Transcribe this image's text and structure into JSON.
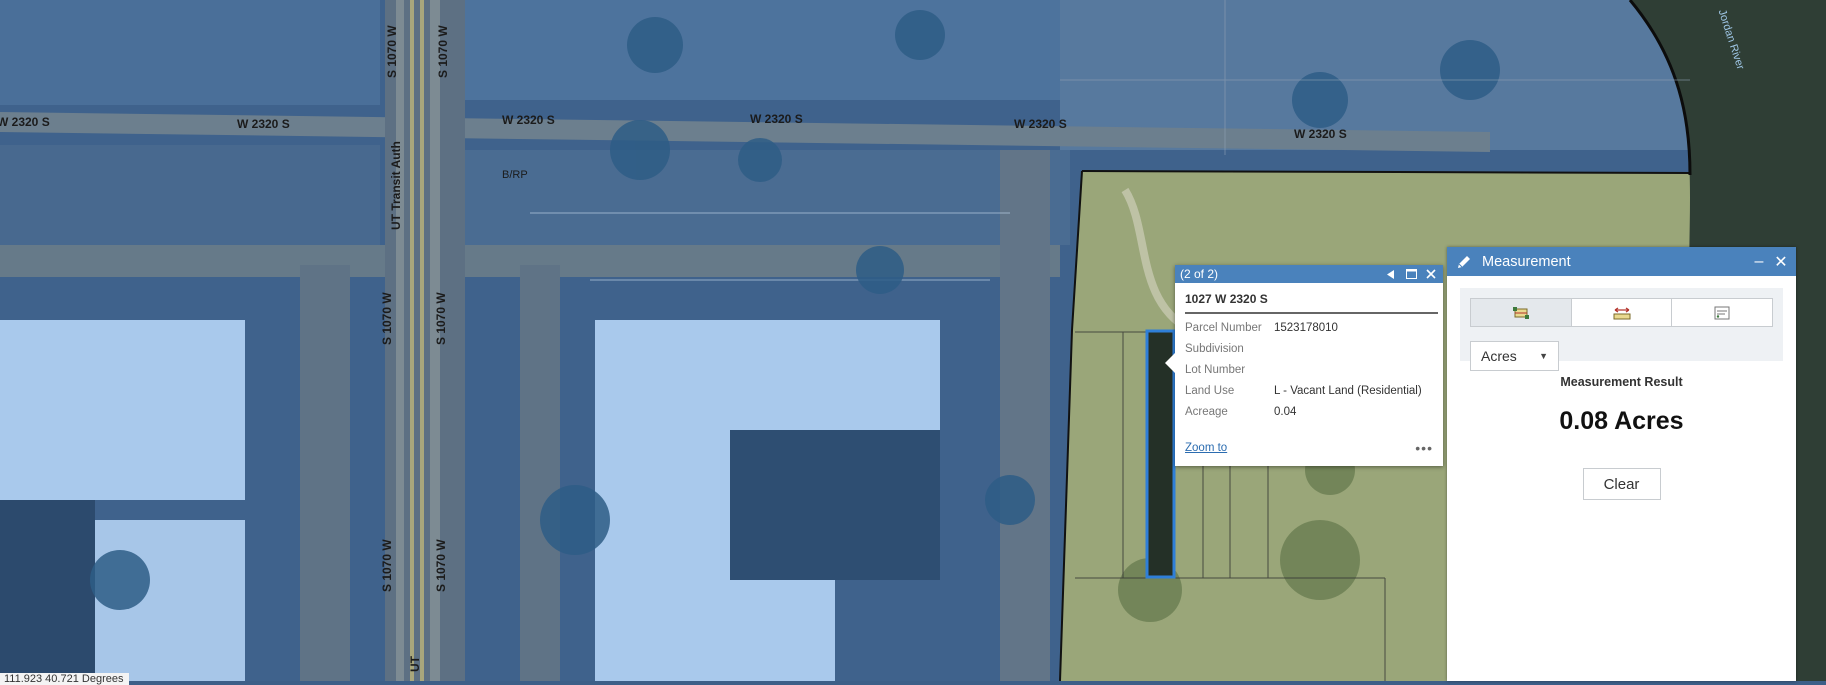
{
  "map": {
    "road_labels": {
      "w2320_a": "W 2320 S",
      "w2320_b": "W 2320 S",
      "w2320_c": "W 2320 S",
      "w2320_d": "W 2320 S",
      "w2320_e": "W 2320 S",
      "w2320_f": "W 2320 S",
      "s1070_top_left": "S 1070 W",
      "s1070_top_right": "S 1070 W",
      "s1070_mid_left": "S 1070 W",
      "s1070_mid_right": "S 1070 W",
      "s1070_bot_left": "S 1070 W",
      "s1070_bot_right": "S 1070 W",
      "ut_transit": "UT Transit Auth",
      "ut_bottom": "UT",
      "brp": "B/RP",
      "river": "Jordan River"
    },
    "coordinates": "111.923 40.721 Degrees"
  },
  "popup": {
    "counter": "(2 of 2)",
    "title": "1027 W 2320 S",
    "fields": [
      {
        "label": "Parcel Number",
        "value": "1523178010"
      },
      {
        "label": "Subdivision",
        "value": ""
      },
      {
        "label": "Lot Number",
        "value": ""
      },
      {
        "label": "Land Use",
        "value": "L - Vacant Land (Residential)"
      },
      {
        "label": "Acreage",
        "value": "0.04"
      }
    ],
    "zoom_link": "Zoom to",
    "more": "•••"
  },
  "measurement": {
    "title": "Measurement",
    "minimize": "–",
    "close": "✕",
    "tools": [
      "area-tool",
      "distance-tool",
      "location-tool"
    ],
    "active_tool": 0,
    "unit": "Acres",
    "result_title": "Measurement Result",
    "result": "0.08 Acres",
    "clear_label": "Clear"
  },
  "colors": {
    "accent": "#4a82bc",
    "map_overlay": "#3d5f88",
    "parcel_highlight": "#2f7fd8"
  }
}
